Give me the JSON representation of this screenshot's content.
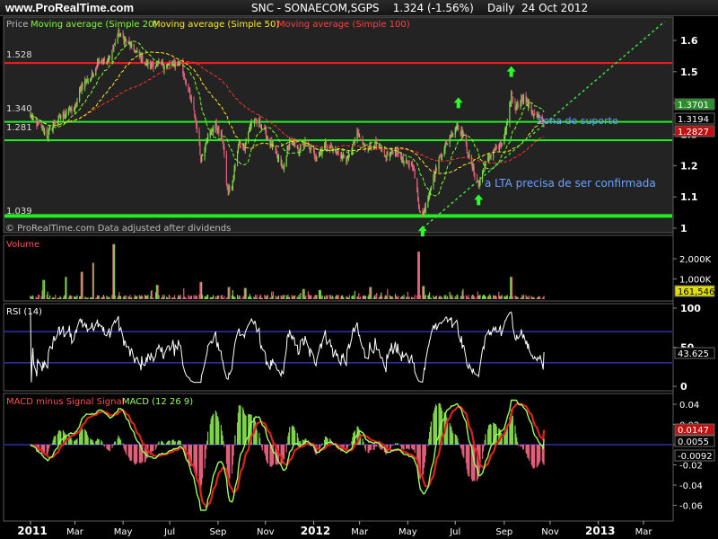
{
  "header": {
    "site": "www.ProRealTime.com",
    "title": "SNC - SONAECOM,SGPS    1.324 (-1.56%)    Daily  24 Oct 2012"
  },
  "colors": {
    "bull": "#7fd34a",
    "bear": "#e0607a",
    "sma20": "#7cff2e",
    "sma50": "#ffeb1a",
    "sma100": "#ff2e2e",
    "resistance": "#ff1a1a",
    "support": "#20ee20",
    "trend": "#3de03d",
    "annotation": "#6aa2ff",
    "rsi": "#ffffff",
    "rsi_band": "#4848ff",
    "macd": "#9cff5c",
    "signal": "#e02020"
  },
  "legend": {
    "price": "Price",
    "sma20": "Moving average (Simple 20)",
    "sma50": "Moving average (Simple 50)",
    "sma100": "Moving average (Simple 100)"
  },
  "price_labels": {
    "top_left": "1.528",
    "upper_support": "1.340",
    "lower_support": "1.281",
    "bottom": "1.039",
    "tag_1": "1.3701",
    "tag_2": "1.3194",
    "tag_3": "1.2827",
    "watermark": "© ProRealTime.com  Data adjusted after dividends"
  },
  "annotations": {
    "support_zone": "Zona de suporte",
    "trendline_note": "a LTA precisa de ser confirmada"
  },
  "volume_panel": {
    "title": "Volume",
    "tag": "161,546"
  },
  "rsi_panel": {
    "title": "RSI (14)",
    "tag": "43.625"
  },
  "macd_panel": {
    "title_hist": "MACD minus Signal Signal",
    "title_macd": "MACD (12 26 9)",
    "tag_1": "0.0147",
    "tag_2": "0.0055",
    "tag_3": "-0.0092"
  },
  "x_axis": {
    "ticks": [
      {
        "label": "2011",
        "date": "2011-01-03",
        "bold": true
      },
      {
        "label": "Mar",
        "date": "2011-03-01"
      },
      {
        "label": "May",
        "date": "2011-05-02"
      },
      {
        "label": "Jul",
        "date": "2011-07-01"
      },
      {
        "label": "Sep",
        "date": "2011-09-01"
      },
      {
        "label": "Nov",
        "date": "2011-11-01"
      },
      {
        "label": "2012",
        "date": "2012-01-02",
        "bold": true
      },
      {
        "label": "Mar",
        "date": "2012-03-01"
      },
      {
        "label": "May",
        "date": "2012-05-02"
      },
      {
        "label": "Jul",
        "date": "2012-07-02"
      },
      {
        "label": "Sep",
        "date": "2012-09-03"
      },
      {
        "label": "Nov",
        "date": "2012-11-01"
      },
      {
        "label": "2013",
        "date": "2013-01-02",
        "bold": true
      },
      {
        "label": "Mar",
        "date": "2013-03-01"
      }
    ]
  },
  "chart_data": [
    {
      "type": "candlestick",
      "title": "SNC - SONAECOM,SGPS",
      "y_ticks": [
        1,
        1.1,
        1.2,
        1.3,
        1.4,
        1.5,
        1.6
      ],
      "y_tick_labels": [
        "1",
        "1.1",
        "1.2",
        "1.3",
        "1.4",
        "1.5",
        "1.6"
      ],
      "ylim": [
        0.98,
        1.67
      ],
      "last_close": 1.324,
      "close_anchors": [
        [
          "2011-01-03",
          1.36
        ],
        [
          "2011-01-12",
          1.33
        ],
        [
          "2011-01-25",
          1.3
        ],
        [
          "2011-02-01",
          1.33
        ],
        [
          "2011-02-15",
          1.37
        ],
        [
          "2011-03-01",
          1.38
        ],
        [
          "2011-03-10",
          1.46
        ],
        [
          "2011-03-22",
          1.48
        ],
        [
          "2011-04-01",
          1.54
        ],
        [
          "2011-04-12",
          1.53
        ],
        [
          "2011-04-26",
          1.62
        ],
        [
          "2011-05-05",
          1.6
        ],
        [
          "2011-05-16",
          1.57
        ],
        [
          "2011-05-30",
          1.53
        ],
        [
          "2011-06-10",
          1.52
        ],
        [
          "2011-06-22",
          1.52
        ],
        [
          "2011-07-05",
          1.52
        ],
        [
          "2011-07-14",
          1.53
        ],
        [
          "2011-07-25",
          1.44
        ],
        [
          "2011-08-03",
          1.35
        ],
        [
          "2011-08-10",
          1.22
        ],
        [
          "2011-08-18",
          1.29
        ],
        [
          "2011-08-29",
          1.33
        ],
        [
          "2011-09-07",
          1.28
        ],
        [
          "2011-09-13",
          1.12
        ],
        [
          "2011-09-19",
          1.13
        ],
        [
          "2011-09-27",
          1.27
        ],
        [
          "2011-10-05",
          1.26
        ],
        [
          "2011-10-14",
          1.34
        ],
        [
          "2011-10-24",
          1.34
        ],
        [
          "2011-11-03",
          1.29
        ],
        [
          "2011-11-14",
          1.24
        ],
        [
          "2011-11-24",
          1.19
        ],
        [
          "2011-12-02",
          1.28
        ],
        [
          "2011-12-13",
          1.25
        ],
        [
          "2011-12-22",
          1.27
        ],
        [
          "2012-01-05",
          1.23
        ],
        [
          "2012-01-18",
          1.27
        ],
        [
          "2012-02-01",
          1.24
        ],
        [
          "2012-02-14",
          1.22
        ],
        [
          "2012-02-27",
          1.3
        ],
        [
          "2012-03-08",
          1.26
        ],
        [
          "2012-03-20",
          1.27
        ],
        [
          "2012-04-03",
          1.23
        ],
        [
          "2012-04-16",
          1.25
        ],
        [
          "2012-04-27",
          1.21
        ],
        [
          "2012-05-09",
          1.2
        ],
        [
          "2012-05-16",
          1.07
        ],
        [
          "2012-05-21",
          1.04
        ],
        [
          "2012-05-28",
          1.1
        ],
        [
          "2012-06-06",
          1.18
        ],
        [
          "2012-06-14",
          1.24
        ],
        [
          "2012-06-25",
          1.29
        ],
        [
          "2012-07-04",
          1.33
        ],
        [
          "2012-07-12",
          1.3
        ],
        [
          "2012-07-23",
          1.2
        ],
        [
          "2012-08-01",
          1.14
        ],
        [
          "2012-08-09",
          1.2
        ],
        [
          "2012-08-20",
          1.25
        ],
        [
          "2012-08-30",
          1.26
        ],
        [
          "2012-09-07",
          1.33
        ],
        [
          "2012-09-12",
          1.43
        ],
        [
          "2012-09-17",
          1.38
        ],
        [
          "2012-09-26",
          1.42
        ],
        [
          "2012-10-05",
          1.39
        ],
        [
          "2012-10-12",
          1.36
        ],
        [
          "2012-10-19",
          1.35
        ],
        [
          "2012-10-24",
          1.324
        ]
      ],
      "horizontal_lines": [
        {
          "name": "resistance",
          "value": 1.528,
          "style": "resistance"
        },
        {
          "name": "upper-support",
          "value": 1.34,
          "style": "support"
        },
        {
          "name": "lower-support",
          "value": 1.281,
          "style": "support"
        },
        {
          "name": "floor",
          "value": 1.039,
          "style": "support"
        }
      ],
      "trendline": {
        "from": [
          "2012-05-21",
          1.0
        ],
        "to": [
          "2013-03-28",
          1.66
        ]
      },
      "arrows": [
        {
          "date": "2012-05-21",
          "value": 0.985,
          "dir": "up"
        },
        {
          "date": "2012-07-06",
          "value": 1.395,
          "dir": "up"
        },
        {
          "date": "2012-08-01",
          "value": 1.085,
          "dir": "up"
        },
        {
          "date": "2012-09-12",
          "value": 1.495,
          "dir": "up"
        }
      ]
    },
    {
      "type": "bar",
      "title": "Volume",
      "y_ticks": [
        1000000,
        2000000
      ],
      "y_tick_labels": [
        "1,000K",
        "2,000K"
      ],
      "ylim": [
        0,
        2800000
      ],
      "last_value": 161546,
      "spikes": [
        [
          "2011-01-20",
          950000
        ],
        [
          "2011-02-18",
          1100000
        ],
        [
          "2011-03-10",
          1350000
        ],
        [
          "2011-03-25",
          1800000
        ],
        [
          "2011-04-20",
          2720000
        ],
        [
          "2011-06-15",
          700000
        ],
        [
          "2011-08-10",
          850000
        ],
        [
          "2011-09-15",
          600000
        ],
        [
          "2011-10-06",
          550000
        ],
        [
          "2011-12-20",
          500000
        ],
        [
          "2012-01-10",
          450000
        ],
        [
          "2012-03-15",
          600000
        ],
        [
          "2012-05-16",
          2350000
        ],
        [
          "2012-05-22",
          650000
        ],
        [
          "2012-09-12",
          1100000
        ]
      ]
    },
    {
      "type": "line",
      "title": "RSI (14)",
      "y_ticks": [
        0,
        50,
        100
      ],
      "y_tick_labels": [
        "0",
        "50",
        "100"
      ],
      "ylim": [
        0,
        100
      ],
      "bands": [
        30,
        70
      ],
      "last_value": 43.625
    },
    {
      "type": "macd",
      "title": "MACD (12 26 9)",
      "y_ticks": [
        -0.06,
        -0.04,
        -0.02,
        0,
        0.02,
        0.04
      ],
      "y_tick_labels": [
        "-0.06",
        "-0.04",
        "-0.02",
        "",
        "0.02",
        "0.04"
      ],
      "ylim": [
        -0.07,
        0.045
      ],
      "last_values": {
        "macd": 0.0055,
        "signal": 0.0147,
        "histogram": -0.0092
      }
    }
  ]
}
